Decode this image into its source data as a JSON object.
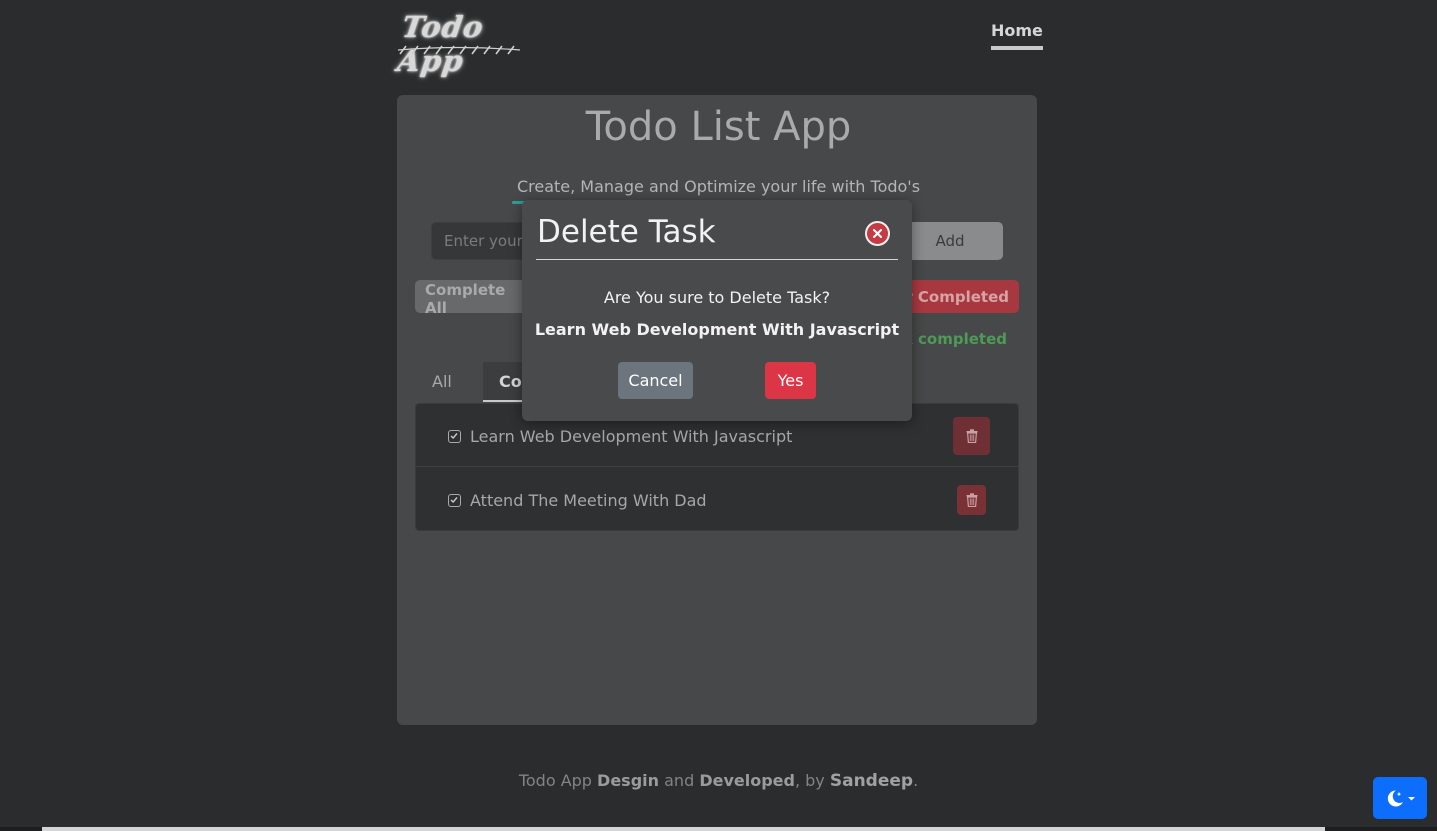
{
  "header": {
    "logo_text": "Todo App",
    "nav_home": "Home"
  },
  "card": {
    "title": "Todo List App",
    "subtitle": "Create, Manage and Optimize your life with Todo's",
    "input_placeholder": "Enter your",
    "add_label": "Add",
    "complete_all_label": "Complete All",
    "clear_completed_label": "r Completed",
    "status_text": "k completed.",
    "tabs": [
      {
        "label": "All"
      },
      {
        "label": "Co"
      }
    ],
    "tasks": [
      {
        "label": "Learn Web Development With Javascript",
        "checked": true
      },
      {
        "label": "Attend The Meeting With Dad",
        "checked": true
      }
    ]
  },
  "modal": {
    "title": "Delete Task",
    "question": "Are You sure to Delete Task?",
    "task_name": "Learn Web Development With Javascript",
    "cancel_label": "Cancel",
    "yes_label": "Yes"
  },
  "footer": {
    "part1": "Todo App ",
    "design": "Desgin",
    "part2": " and ",
    "developed": "Developed",
    "part3": ", by ",
    "author": "Sandeep",
    "part4": "."
  },
  "colors": {
    "accent_blue": "#0d6efd",
    "danger": "#dc3545",
    "secondary": "#6c757d",
    "success_text": "#4e9a57"
  },
  "icons": {
    "theme_toggle": "moon-icon",
    "delete": "trash-icon",
    "close": "close-circle-icon",
    "checkbox": "checkbox-checked-icon"
  }
}
